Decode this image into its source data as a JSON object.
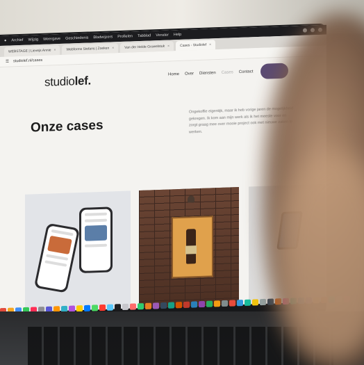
{
  "menubar": {
    "items": [
      "Archief",
      "Wijzig",
      "Weergave",
      "Geschiedenis",
      "Bladwijzers",
      "Profielen",
      "Tabblad",
      "Venster",
      "Help"
    ]
  },
  "tabs": [
    {
      "label": "WEBSTAGE | Lievejs Annie"
    },
    {
      "label": "Webforms Stefans | Zoeken"
    },
    {
      "label": "Van der Helde Gruwelstuk"
    },
    {
      "label": "Cases - Studiolef"
    }
  ],
  "urlbar": {
    "text": "studiolef.nl/cases"
  },
  "site": {
    "logo_a": "studio",
    "logo_b": "lef.",
    "nav": [
      "Home",
      "Over",
      "Diensten",
      "Cases",
      "Contact"
    ],
    "heading": "Onze cases",
    "intro": "Ongekoffie eigentijk, maar ik heb vorige jaren de mogelijkheid gekregen. Ik kom aan mijn werk als ik het meeste voor en zorgt graag mee over mooie project ook met nieuwe zaken te werken."
  },
  "colors": {
    "nav_button": "#5a4a73",
    "background": "#f4f3f0"
  },
  "dock_colors": [
    "#e34b3b",
    "#f5a623",
    "#3f8ef5",
    "#34c759",
    "#ff2d55",
    "#8e8e93",
    "#5856d6",
    "#ff9500",
    "#30b0c7",
    "#af52de",
    "#ffcc00",
    "#007aff",
    "#4cd964",
    "#ff3b30",
    "#5ac8fa",
    "#1d1d1f",
    "#c7c7cc",
    "#ff6b6b",
    "#2ecc71",
    "#e67e22",
    "#9b59b6",
    "#34495e",
    "#16a085",
    "#d35400",
    "#c0392b",
    "#2980b9",
    "#8e44ad",
    "#27ae60",
    "#f39c12",
    "#7f8c8d",
    "#e74c3c",
    "#3498db",
    "#1abc9c",
    "#f1c40f",
    "#95a5a6",
    "#2c3e50",
    "#d35400",
    "#e84393",
    "#00b894",
    "#0984e3",
    "#6c5ce7",
    "#fdcb6e",
    "#e17055",
    "#00cec9",
    "#b2bec3",
    "#fd79a8"
  ]
}
